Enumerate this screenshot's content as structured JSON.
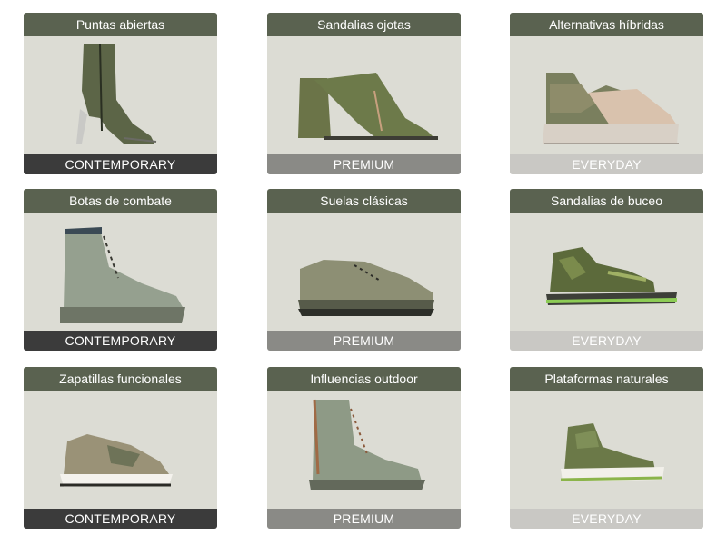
{
  "products": [
    {
      "title": "Puntas abiertas",
      "tier": "CONTEMPORARY",
      "icon": "open-toe-bootie-icon"
    },
    {
      "title": "Sandalias ojotas",
      "tier": "PREMIUM",
      "icon": "flip-flop-heel-icon"
    },
    {
      "title": "Alternativas híbridas",
      "tier": "EVERYDAY",
      "icon": "hybrid-platform-sandal-icon"
    },
    {
      "title": "Botas de combate",
      "tier": "CONTEMPORARY",
      "icon": "combat-boot-icon"
    },
    {
      "title": "Suelas clásicas",
      "tier": "PREMIUM",
      "icon": "classic-sole-sneaker-icon"
    },
    {
      "title": "Sandalias de buceo",
      "tier": "EVERYDAY",
      "icon": "sport-sandal-icon"
    },
    {
      "title": "Zapatillas funcionales",
      "tier": "CONTEMPORARY",
      "icon": "functional-sneaker-icon"
    },
    {
      "title": "Influencias outdoor",
      "tier": "PREMIUM",
      "icon": "outdoor-boot-icon"
    },
    {
      "title": "Plataformas naturales",
      "tier": "EVERYDAY",
      "icon": "natural-platform-sandal-icon"
    }
  ]
}
